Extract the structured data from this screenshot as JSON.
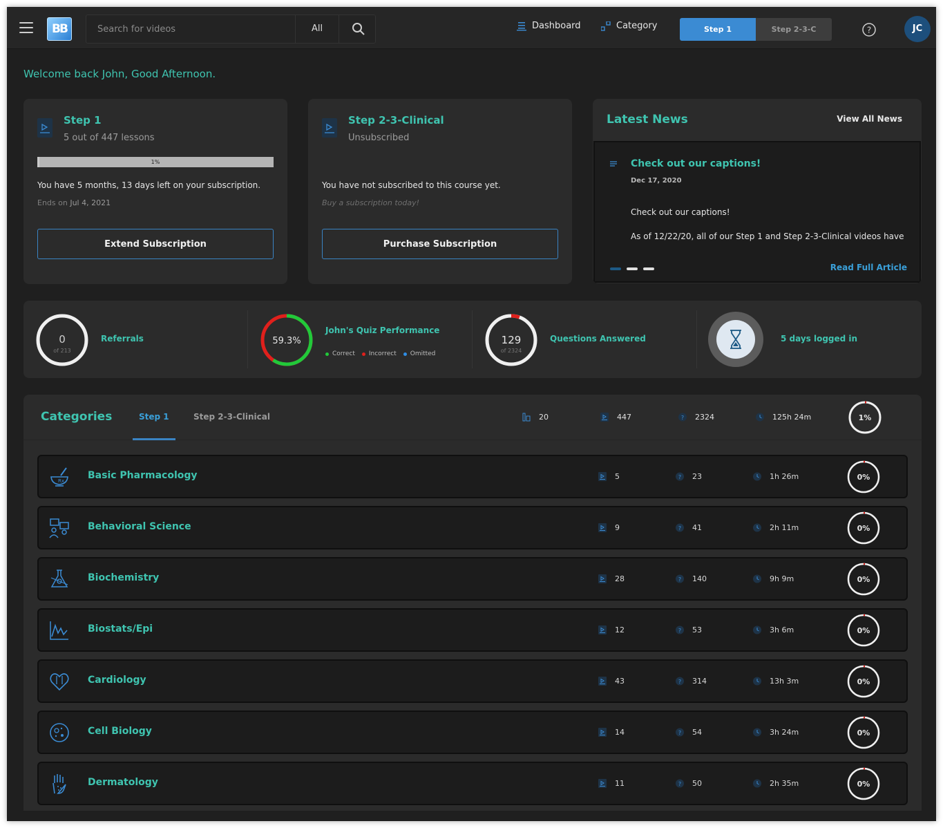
{
  "header": {
    "search_placeholder": "Search for videos",
    "search_scope": "All",
    "nav": [
      {
        "label": "Dashboard",
        "icon": "dashboard-icon"
      },
      {
        "label": "Category",
        "icon": "category-icon"
      }
    ],
    "step_buttons": [
      "Step 1",
      "Step 2-3-C"
    ],
    "avatar_initials": "JC",
    "logo_text": "BB"
  },
  "welcome": "Welcome back John, Good Afternoon.",
  "courses": [
    {
      "title": "Step 1",
      "subtitle": "5 out of 447 lessons",
      "progress_percent": 1,
      "progress_label": "1%",
      "message": "You have 5 months, 13 days left on your subscription.",
      "end_prefix": "Ends on",
      "end_date": "Jul 4, 2021",
      "button": "Extend Subscription"
    },
    {
      "title": "Step 2-3-Clinical",
      "subtitle": "Unsubscribed",
      "message": "You have not subscribed to this course yet.",
      "note": "Buy a subscription today!",
      "button": "Purchase Subscription"
    }
  ],
  "news": {
    "title": "Latest News",
    "view_all": "View All News",
    "article_title": "Check out our captions!",
    "article_date": "Dec 17, 2020",
    "paragraph1": "Check out our captions!",
    "paragraph2": "As of 12/22/20, all of our Step 1 and Step 2-3-Clinical videos have",
    "read_more": "Read Full Article",
    "active_slide": 1,
    "slide_count": 3
  },
  "stats": {
    "referrals": {
      "value": "0",
      "sub": "of 213",
      "label": "Referrals"
    },
    "quiz": {
      "value": "59.3%",
      "label": "John's Quiz Performance",
      "correct_percent": 59.3,
      "incorrect_percent": 40.7,
      "legend": [
        "Correct",
        "Incorrect",
        "Omitted"
      ]
    },
    "questions": {
      "value": "129",
      "sub": "of 2324",
      "label": "Questions Answered",
      "fraction": 0.055
    },
    "logins": {
      "label": "5 days logged in"
    }
  },
  "categories": {
    "title": "Categories",
    "tabs": [
      "Step 1",
      "Step 2-3-Clinical"
    ],
    "totals": {
      "categories": "20",
      "lessons": "447",
      "questions": "2324",
      "duration": "125h 24m",
      "progress": "1%"
    },
    "rows": [
      {
        "name": "Basic Pharmacology",
        "icon": "mortar-pestle-icon",
        "lessons": "5",
        "questions": "23",
        "duration": "1h 26m",
        "progress": "0%"
      },
      {
        "name": "Behavioral Science",
        "icon": "people-chat-icon",
        "lessons": "9",
        "questions": "41",
        "duration": "2h 11m",
        "progress": "0%"
      },
      {
        "name": "Biochemistry",
        "icon": "molecule-flask-icon",
        "lessons": "28",
        "questions": "140",
        "duration": "9h 9m",
        "progress": "0%"
      },
      {
        "name": "Biostats/Epi",
        "icon": "line-graph-icon",
        "lessons": "12",
        "questions": "53",
        "duration": "3h 6m",
        "progress": "0%"
      },
      {
        "name": "Cardiology",
        "icon": "heart-icon",
        "lessons": "43",
        "questions": "314",
        "duration": "13h 3m",
        "progress": "0%"
      },
      {
        "name": "Cell Biology",
        "icon": "cell-icon",
        "lessons": "14",
        "questions": "54",
        "duration": "3h 24m",
        "progress": "0%"
      },
      {
        "name": "Dermatology",
        "icon": "hand-icon",
        "lessons": "11",
        "questions": "50",
        "duration": "2h 35m",
        "progress": "0%"
      }
    ]
  },
  "colors": {
    "accent_teal": "#3fc4b0",
    "accent_blue": "#3b8bd3",
    "correct": "#21c93a",
    "incorrect": "#e0201c",
    "omitted": "#2f8de4"
  }
}
